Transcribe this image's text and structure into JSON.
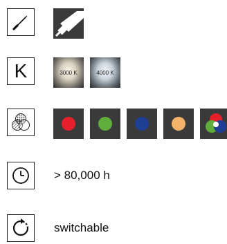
{
  "rows": [
    {
      "icon": "screwdriver-icon",
      "tiles": [
        {
          "icon": "spotlight-beam-icon"
        }
      ]
    },
    {
      "icon": "kelvin-icon",
      "icon_letter": "K",
      "tiles": [
        {
          "label": "3000 K"
        },
        {
          "label": "4000 K"
        }
      ]
    },
    {
      "icon": "color-mix-icon",
      "colors": [
        {
          "name": "red",
          "hex": "#e5202a"
        },
        {
          "name": "green",
          "hex": "#5fae3c"
        },
        {
          "name": "blue",
          "hex": "#1f3f95"
        },
        {
          "name": "orange",
          "hex": "#f3b36b"
        },
        {
          "name": "rgb",
          "hex": "#ffffff"
        }
      ]
    },
    {
      "icon": "clock-icon",
      "text": "> 80,000 h"
    },
    {
      "icon": "switch-cycle-icon",
      "text": "switchable"
    }
  ],
  "colors": {
    "tile_background": "#3a3a3a",
    "border": "#222222",
    "text": "#111111"
  }
}
